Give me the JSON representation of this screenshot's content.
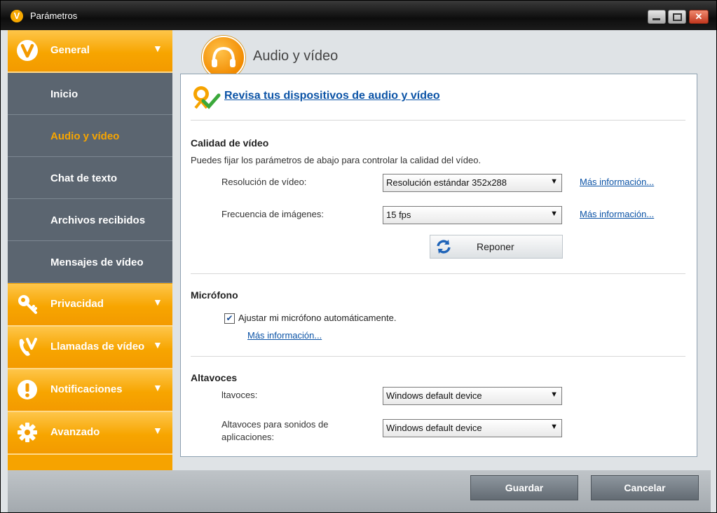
{
  "window": {
    "title": "Parámetros",
    "logo_letter": "V"
  },
  "sidebar": {
    "general": {
      "label": "General",
      "icon": "viber-logo-icon"
    },
    "items": [
      {
        "label": "Inicio",
        "active": false
      },
      {
        "label": "Audio y vídeo",
        "active": true
      },
      {
        "label": "Chat de texto",
        "active": false
      },
      {
        "label": "Archivos recibidos",
        "active": false
      },
      {
        "label": "Mensajes de vídeo",
        "active": false
      }
    ],
    "groups": [
      {
        "label": "Privacidad",
        "icon": "key-icon"
      },
      {
        "label": "Llamadas de vídeo",
        "icon": "video-call-icon"
      },
      {
        "label": "Notificaciones",
        "icon": "exclamation-icon"
      },
      {
        "label": "Avanzado",
        "icon": "gear-icon"
      }
    ],
    "chevron": "▼"
  },
  "main": {
    "title": "Audio y vídeo",
    "check_link": "Revisa tus dispositivos de audio y vídeo",
    "video_quality": {
      "title": "Calidad de vídeo",
      "description": "Puedes fijar los parámetros de abajo para controlar la calidad del vídeo.",
      "resolution": {
        "label": "Resolución de vídeo:",
        "value": "Resolución estándar 352x288",
        "more": "Más información..."
      },
      "framerate": {
        "label": "Frecuencia de imágenes:",
        "value": "15 fps",
        "more": "Más información..."
      },
      "reset_label": "Reponer"
    },
    "microphone": {
      "title": "Micrófono",
      "auto_adjust": {
        "label": "Ajustar mi micrófono automáticamente.",
        "checked": true
      },
      "more": "Más información..."
    },
    "speakers": {
      "title": "Altavoces",
      "speaker": {
        "label": "ltavoces:",
        "value": "Windows default device"
      },
      "app_sounds": {
        "label": "Altavoces para sonidos de aplicaciones:",
        "value": "Windows default device"
      }
    }
  },
  "footer": {
    "save": "Guardar",
    "cancel": "Cancelar"
  }
}
